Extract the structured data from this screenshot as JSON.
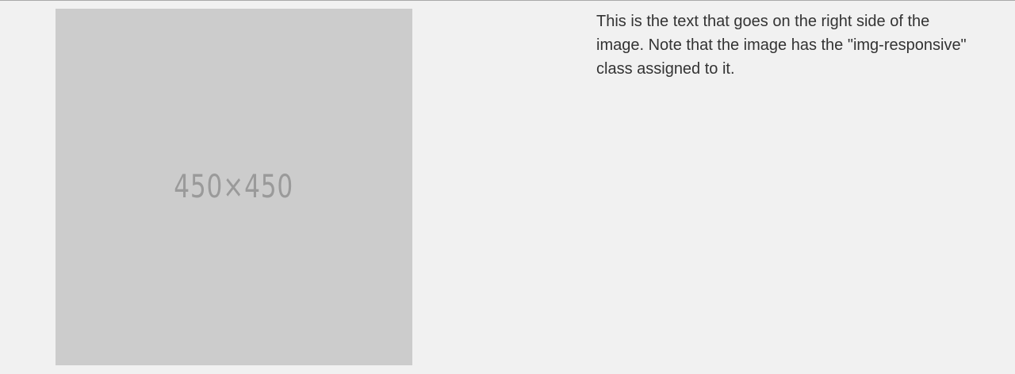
{
  "image": {
    "placeholder_label": "450×450",
    "background_color": "#cccccc",
    "text_color": "#9a9a9a"
  },
  "content": {
    "description": "This is the text that goes on the right side of the image. Note that the image has the \"img-responsive\" class assigned to it."
  },
  "colors": {
    "page_background": "#f1f1f1",
    "body_text": "#333333",
    "top_rule": "#a9a9a9"
  }
}
